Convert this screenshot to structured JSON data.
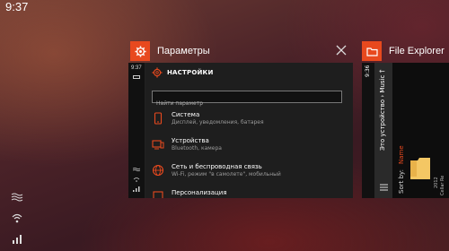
{
  "status": {
    "time": "9:37"
  },
  "card_settings": {
    "title": "Параметры",
    "phone_time": "9:37",
    "header": "НАСТРОЙКИ",
    "search_placeholder": "Найти параметр",
    "items": [
      {
        "title": "Система",
        "subtitle": "Дисплей, уведомления, батарея",
        "icon": "phone-icon"
      },
      {
        "title": "Устройства",
        "subtitle": "Bluetooth, камера",
        "icon": "devices-icon"
      },
      {
        "title": "Сеть и беспроводная связь",
        "subtitle": "Wi-Fi, режим \"в самолете\", мобильный",
        "icon": "globe-icon"
      },
      {
        "title": "Персонализация",
        "subtitle": "",
        "icon": "personalize-icon"
      }
    ]
  },
  "card_explorer": {
    "title": "File Explorer",
    "phone_time": "9:36",
    "breadcrumb": "Это устройство  ›  Music",
    "sort_label": "Sort by:",
    "sort_value": "Name",
    "folder_date": "2012",
    "folder_name": "Cellar Re"
  },
  "colors": {
    "accent": "#e8491e",
    "accent_text": "#e8491e"
  }
}
